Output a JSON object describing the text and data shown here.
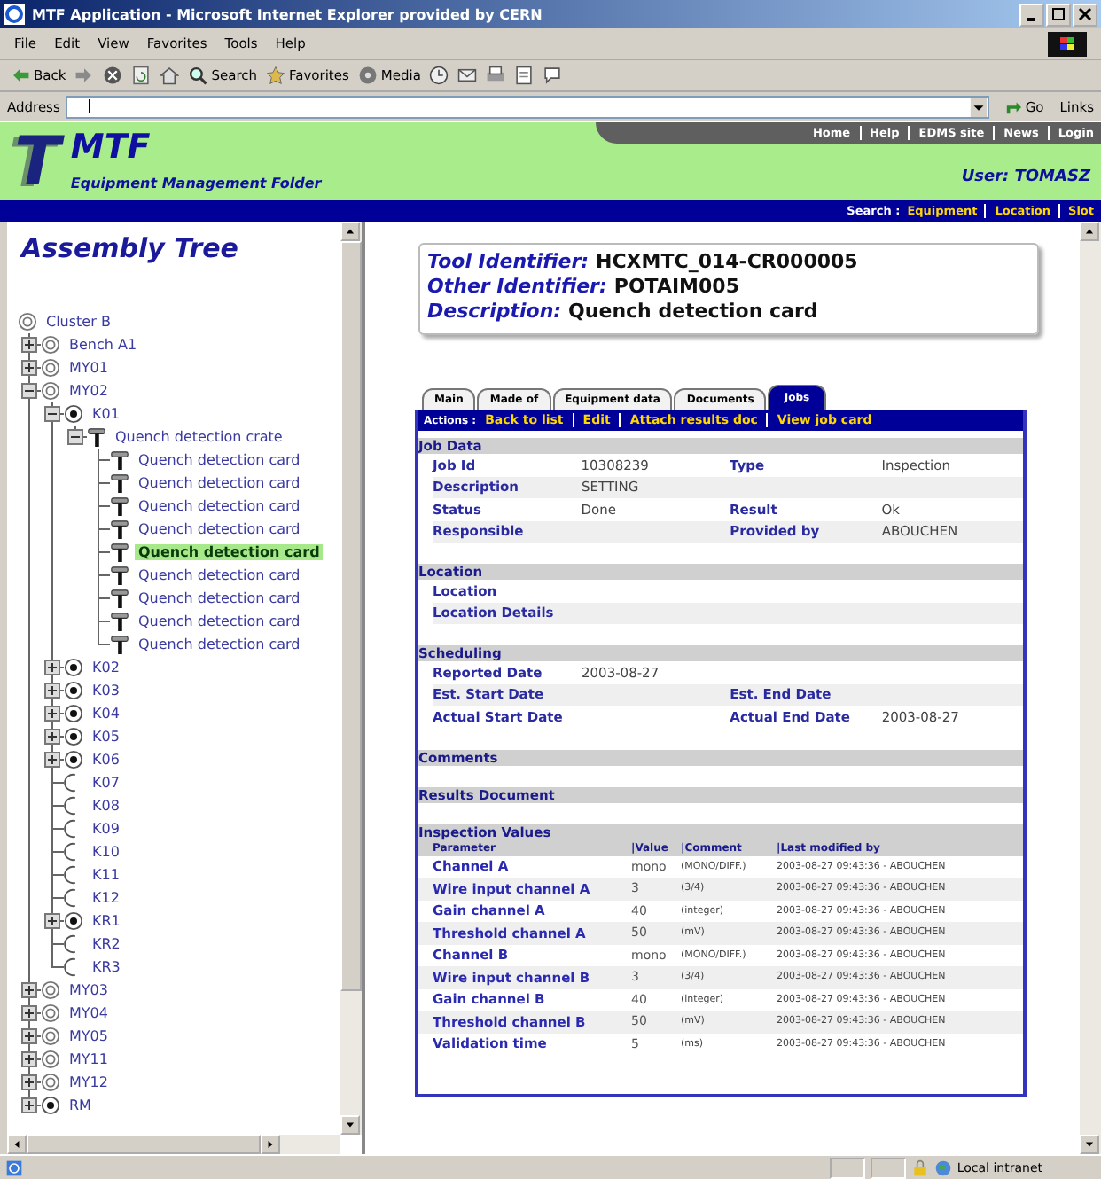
{
  "window": {
    "title": "MTF Application - Microsoft Internet Explorer provided by CERN"
  },
  "menu": [
    "File",
    "Edit",
    "View",
    "Favorites",
    "Tools",
    "Help"
  ],
  "toolbar": [
    {
      "kind": "back",
      "label": "Back"
    },
    {
      "kind": "forward"
    },
    {
      "kind": "stop"
    },
    {
      "kind": "refresh"
    },
    {
      "kind": "home"
    },
    {
      "kind": "search",
      "label": "Search"
    },
    {
      "kind": "favorites",
      "label": "Favorites"
    },
    {
      "kind": "media",
      "label": "Media"
    },
    {
      "kind": "history"
    },
    {
      "kind": "mail"
    },
    {
      "kind": "print"
    },
    {
      "kind": "edit"
    },
    {
      "kind": "discuss"
    }
  ],
  "address": {
    "label": "Address",
    "go": "Go",
    "links": "Links"
  },
  "header": {
    "logo": "T",
    "title": "MTF",
    "subtitle": "Equipment Management Folder",
    "nav": [
      "Home",
      "Help",
      "EDMS site",
      "News",
      "Login"
    ],
    "user": "User: TOMASZ"
  },
  "search": {
    "label": "Search :",
    "links": [
      "Equipment",
      "Location",
      "Slot"
    ]
  },
  "tree": {
    "title": "Assembly Tree",
    "nodes": [
      {
        "label": "Cluster B",
        "kind": "ring",
        "selected": false,
        "children": [
          {
            "label": "Bench A1",
            "kind": "ring",
            "selected": false,
            "expanded": false
          },
          {
            "label": "MY01",
            "kind": "ring",
            "selected": false,
            "expanded": false
          },
          {
            "label": "MY02",
            "kind": "ring",
            "selected": false,
            "expanded": true,
            "children": [
              {
                "label": "K01",
                "kind": "dot",
                "selected": false,
                "expanded": true,
                "children": [
                  {
                    "label": "Quench detection crate",
                    "kind": "crate",
                    "selected": false,
                    "expanded": true,
                    "children": [
                      {
                        "label": "Quench detection card",
                        "kind": "card",
                        "selected": false
                      },
                      {
                        "label": "Quench detection card",
                        "kind": "card",
                        "selected": false
                      },
                      {
                        "label": "Quench detection card",
                        "kind": "card",
                        "selected": false
                      },
                      {
                        "label": "Quench detection card",
                        "kind": "card",
                        "selected": false
                      },
                      {
                        "label": "Quench detection card",
                        "kind": "card",
                        "selected": true
                      },
                      {
                        "label": "Quench detection card",
                        "kind": "card",
                        "selected": false
                      },
                      {
                        "label": "Quench detection card",
                        "kind": "card",
                        "selected": false
                      },
                      {
                        "label": "Quench detection card",
                        "kind": "card",
                        "selected": false
                      },
                      {
                        "label": "Quench detection card",
                        "kind": "card",
                        "selected": false
                      }
                    ]
                  }
                ]
              },
              {
                "label": "K02",
                "kind": "dot",
                "selected": false,
                "expanded": false
              },
              {
                "label": "K03",
                "kind": "dot",
                "selected": false,
                "expanded": false
              },
              {
                "label": "K04",
                "kind": "dot",
                "selected": false,
                "expanded": false
              },
              {
                "label": "K05",
                "kind": "dot",
                "selected": false,
                "expanded": false
              },
              {
                "label": "K06",
                "kind": "dot",
                "selected": false,
                "expanded": false
              },
              {
                "label": "K07",
                "kind": "open",
                "selected": false
              },
              {
                "label": "K08",
                "kind": "open",
                "selected": false
              },
              {
                "label": "K09",
                "kind": "open",
                "selected": false
              },
              {
                "label": "K10",
                "kind": "open",
                "selected": false
              },
              {
                "label": "K11",
                "kind": "open",
                "selected": false
              },
              {
                "label": "K12",
                "kind": "open",
                "selected": false
              },
              {
                "label": "KR1",
                "kind": "dot",
                "selected": false,
                "expanded": false
              },
              {
                "label": "KR2",
                "kind": "open",
                "selected": false
              },
              {
                "label": "KR3",
                "kind": "open",
                "selected": false
              }
            ]
          },
          {
            "label": "MY03",
            "kind": "ring",
            "selected": false,
            "expanded": false
          },
          {
            "label": "MY04",
            "kind": "ring",
            "selected": false,
            "expanded": false
          },
          {
            "label": "MY05",
            "kind": "ring",
            "selected": false,
            "expanded": false
          },
          {
            "label": "MY11",
            "kind": "ring",
            "selected": false,
            "expanded": false
          },
          {
            "label": "MY12",
            "kind": "ring",
            "selected": false,
            "expanded": false
          },
          {
            "label": "RM",
            "kind": "dot",
            "selected": false,
            "expanded": false
          }
        ]
      }
    ]
  },
  "identity": [
    {
      "label": "Tool Identifier:",
      "value": "HCXMTC_014-CR000005"
    },
    {
      "label": "Other Identifier:",
      "value": "POTAIM005"
    },
    {
      "label": "Description:",
      "value": "Quench detection card"
    }
  ],
  "tabs": [
    {
      "label": "Main",
      "selected": false
    },
    {
      "label": "Made of",
      "selected": false
    },
    {
      "label": "Equipment data",
      "selected": false
    },
    {
      "label": "Documents",
      "selected": false
    },
    {
      "label": "Jobs",
      "selected": true
    }
  ],
  "actions": {
    "label": "Actions :",
    "links": [
      "Back to list",
      "Edit",
      "Attach results doc",
      "View job card"
    ]
  },
  "sections": [
    {
      "title": "Job Data",
      "rows": [
        [
          {
            "label": "Job Id",
            "value": "10308239"
          },
          {
            "label": "Type",
            "value": "Inspection"
          }
        ],
        [
          {
            "label": "Description",
            "value": "SETTING"
          }
        ],
        [
          {
            "label": "Status",
            "value": "Done"
          },
          {
            "label": "Result",
            "value": "Ok"
          }
        ],
        [
          {
            "label": "Responsible"
          },
          {
            "label": "Provided by",
            "value": "ABOUCHEN"
          }
        ]
      ]
    },
    {
      "title": "Location",
      "rows": [
        [
          {
            "label": "Location"
          }
        ],
        [
          {
            "label": "Location Details"
          }
        ]
      ]
    },
    {
      "title": "Scheduling",
      "rows": [
        [
          {
            "label": "Reported Date",
            "value": "2003-08-27"
          }
        ],
        [
          {
            "label": "Est. Start Date"
          },
          {
            "label": "Est. End Date"
          }
        ],
        [
          {
            "label": "Actual Start Date"
          },
          {
            "label": "Actual End Date",
            "value": "2003-08-27"
          }
        ]
      ]
    },
    {
      "title": "Comments"
    },
    {
      "title": "Results Document"
    }
  ],
  "inspection": {
    "title": "Inspection Values",
    "columns": [
      "Parameter",
      "|Value",
      "|Comment",
      "|Last modified by"
    ],
    "rows": [
      {
        "parameter": "Channel A",
        "value": "mono",
        "comment": "(MONO/DIFF.)",
        "modified": "2003-08-27 09:43:36 - ABOUCHEN"
      },
      {
        "parameter": "Wire input channel A",
        "value": "3",
        "comment": "(3/4)",
        "modified": "2003-08-27 09:43:36 - ABOUCHEN"
      },
      {
        "parameter": "Gain channel A",
        "value": "40",
        "comment": "(integer)",
        "modified": "2003-08-27 09:43:36 - ABOUCHEN"
      },
      {
        "parameter": "Threshold channel A",
        "value": "50",
        "comment": "(mV)",
        "modified": "2003-08-27 09:43:36 - ABOUCHEN"
      },
      {
        "parameter": "Channel B",
        "value": "mono",
        "comment": "(MONO/DIFF.)",
        "modified": "2003-08-27 09:43:36 - ABOUCHEN"
      },
      {
        "parameter": "Wire input channel B",
        "value": "3",
        "comment": "(3/4)",
        "modified": "2003-08-27 09:43:36 - ABOUCHEN"
      },
      {
        "parameter": "Gain channel B",
        "value": "40",
        "comment": "(integer)",
        "modified": "2003-08-27 09:43:36 - ABOUCHEN"
      },
      {
        "parameter": "Threshold channel B",
        "value": "50",
        "comment": "(mV)",
        "modified": "2003-08-27 09:43:36 - ABOUCHEN"
      },
      {
        "parameter": "Validation time",
        "value": "5",
        "comment": "(ms)",
        "modified": "2003-08-27 09:43:36 - ABOUCHEN"
      }
    ]
  },
  "status_bar": {
    "zone": "Local intranet"
  }
}
